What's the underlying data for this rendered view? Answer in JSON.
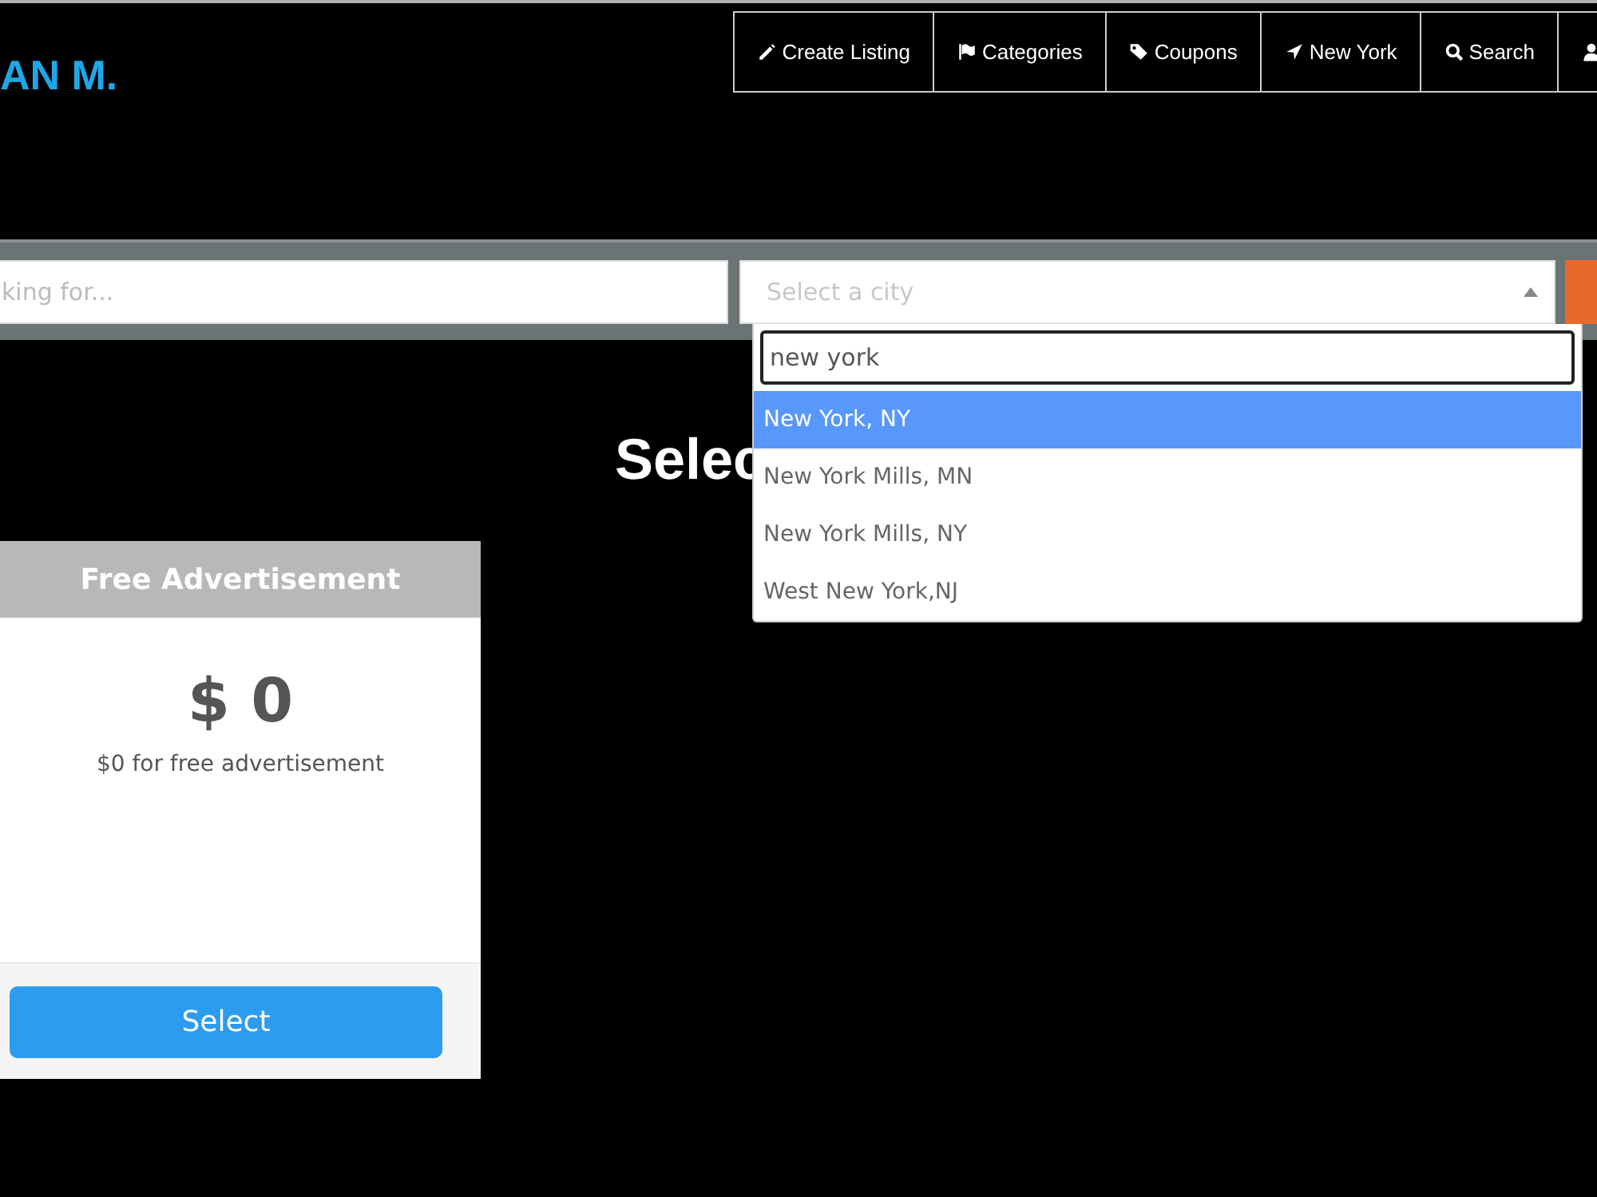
{
  "logo": "AN M.",
  "nav": [
    {
      "label": "Create Listing",
      "kind": "pencil"
    },
    {
      "label": "Categories",
      "kind": "flag"
    },
    {
      "label": "Coupons",
      "kind": "tag"
    },
    {
      "label": "New York",
      "kind": "location"
    },
    {
      "label": "Search",
      "kind": "search"
    },
    {
      "kind": "user"
    }
  ],
  "search_bar": {
    "keyword": {
      "placeholder": "king for..."
    },
    "city": {
      "placeholder": "Select a city"
    }
  },
  "city_dropdown": {
    "query": "new york",
    "options": [
      {
        "label": "New York, NY",
        "selected": true
      },
      {
        "label": "New York Mills, MN",
        "selected": false
      },
      {
        "label": "New York Mills, NY",
        "selected": false
      },
      {
        "label": "West New York,NJ",
        "selected": false
      }
    ]
  },
  "heading": "Selec",
  "plan": {
    "title": "Free Advertisement",
    "price": "$ 0",
    "description": "$0 for free advertisement",
    "button": "Select"
  }
}
